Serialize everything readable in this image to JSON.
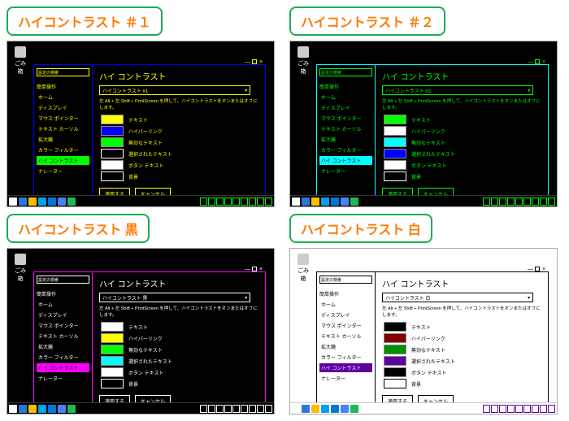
{
  "themes": [
    {
      "title": "ハイコントラスト ＃１",
      "mode": "dark",
      "accent": "#00ff00",
      "border": "#0000ff",
      "text_color": "#ffff00",
      "desktop_icon_label": "ごみ箱",
      "heading": "ハイ コントラスト",
      "dropdown": "ハイコントラスト #1",
      "desc": "左 Alt + 左 Shift + PrintScreen を押して、ハイコントラストをオンまたはオフにします。",
      "search_label": "設定の検索",
      "group_label": "簡単操作",
      "sidebar": [
        "ホーム",
        "ディスプレイ",
        "マウス ポインター",
        "テキスト カーソル",
        "拡大鏡",
        "カラー フィルター",
        "ハイ コントラスト",
        "ナレーター"
      ],
      "sidebar_sel": 6,
      "swatches": [
        {
          "color": "#ffff00",
          "label": "テキスト"
        },
        {
          "color": "#0000ff",
          "label": "ハイパーリンク"
        },
        {
          "color": "#00ff00",
          "label": "無効なテキスト"
        },
        {
          "color": "#000000",
          "label": "選択されたテキスト",
          "outline": "#fff"
        },
        {
          "color": "#ffffff",
          "label": "ボタン テキスト"
        },
        {
          "color": "#000000",
          "label": "背景",
          "outline": "#fff"
        }
      ],
      "buttons": [
        "適用する",
        "キャンセル"
      ],
      "taskbar_tint": "#00ff00"
    },
    {
      "title": "ハイコントラスト ＃２",
      "mode": "dark",
      "accent": "#00ffff",
      "border": "#00ffff",
      "text_color": "#00ff00",
      "desktop_icon_label": "ごみ箱",
      "heading": "ハイ コントラスト",
      "dropdown": "ハイコントラスト #2",
      "desc": "左 Alt + 左 Shift + PrintScreen を押して、ハイコントラストをオンまたはオフにします。",
      "search_label": "設定の検索",
      "group_label": "簡単操作",
      "sidebar": [
        "ホーム",
        "ディスプレイ",
        "マウス ポインター",
        "テキスト カーソル",
        "拡大鏡",
        "カラー フィルター",
        "ハイ コントラスト",
        "ナレーター"
      ],
      "sidebar_sel": 6,
      "swatches": [
        {
          "color": "#00ff00",
          "label": "テキスト"
        },
        {
          "color": "#ffffff",
          "label": "ハイパーリンク"
        },
        {
          "color": "#00ffff",
          "label": "無効なテキスト"
        },
        {
          "color": "#0000ff",
          "label": "選択されたテキスト"
        },
        {
          "color": "#ffffff",
          "label": "ボタン テキスト"
        },
        {
          "color": "#000000",
          "label": "背景",
          "outline": "#fff"
        }
      ],
      "buttons": [
        "適用する",
        "キャンセル"
      ],
      "taskbar_tint": "#00ff00"
    },
    {
      "title": "ハイコントラスト 黒",
      "mode": "dark",
      "accent": "#ff00ff",
      "border": "#ff00ff",
      "text_color": "#ffffff",
      "desktop_icon_label": "ごみ箱",
      "heading": "ハイ コントラスト",
      "dropdown": "ハイコントラスト 黒",
      "desc": "左 Alt + 左 Shift + PrintScreen を押して、ハイコントラストをオンまたはオフにします。",
      "search_label": "設定の検索",
      "group_label": "簡単操作",
      "sidebar": [
        "ホーム",
        "ディスプレイ",
        "マウス ポインター",
        "テキスト カーソル",
        "拡大鏡",
        "カラー フィルター",
        "ハイ コントラスト",
        "ナレーター"
      ],
      "sidebar_sel": 6,
      "swatches": [
        {
          "color": "#ffffff",
          "label": "テキスト"
        },
        {
          "color": "#ffff00",
          "label": "ハイパーリンク"
        },
        {
          "color": "#00ff00",
          "label": "無効なテキスト"
        },
        {
          "color": "#00ffff",
          "label": "選択されたテキスト"
        },
        {
          "color": "#ffffff",
          "label": "ボタン テキスト"
        },
        {
          "color": "#000000",
          "label": "背景",
          "outline": "#fff"
        }
      ],
      "buttons": [
        "適用する",
        "キャンセル"
      ],
      "taskbar_tint": "#ffffff"
    },
    {
      "title": "ハイコントラスト 白",
      "mode": "light",
      "accent": "#6000a0",
      "border": "#000000",
      "text_color": "#000000",
      "desktop_icon_label": "ごみ箱",
      "heading": "ハイ コントラスト",
      "dropdown": "ハイコントラスト 白",
      "desc": "左 Alt + 左 Shift + PrintScreen を押して、ハイコントラストをオンまたはオフにします。",
      "search_label": "設定の検索",
      "group_label": "簡単操作",
      "sidebar": [
        "ホーム",
        "ディスプレイ",
        "マウス ポインター",
        "テキスト カーソル",
        "拡大鏡",
        "カラー フィルター",
        "ハイ コントラスト",
        "ナレーター"
      ],
      "sidebar_sel": 6,
      "swatches": [
        {
          "color": "#000000",
          "label": "テキスト"
        },
        {
          "color": "#800000",
          "label": "ハイパーリンク"
        },
        {
          "color": "#009000",
          "label": "無効なテキスト"
        },
        {
          "color": "#6000a0",
          "label": "選択されたテキスト"
        },
        {
          "color": "#000000",
          "label": "ボタン テキスト"
        },
        {
          "color": "#ffffff",
          "label": "背景",
          "outline": "#000"
        }
      ],
      "buttons": [
        "適用する",
        "キャンセル"
      ],
      "taskbar_tint": "#6000a0"
    }
  ]
}
